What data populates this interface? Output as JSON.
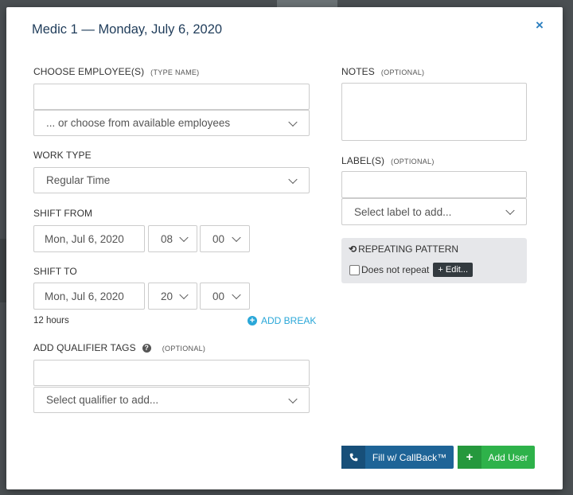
{
  "modal": {
    "title": "Medic 1 — Monday, July 6, 2020",
    "close_glyph": "×"
  },
  "employees": {
    "label": "CHOOSE EMPLOYEE(S)",
    "hint": "(TYPE NAME)",
    "input_value": "",
    "select_value": "... or choose from available employees"
  },
  "work_type": {
    "label": "WORK TYPE",
    "value": "Regular Time"
  },
  "shift_from": {
    "label": "SHIFT FROM",
    "date": "Mon, Jul 6, 2020",
    "hour": "08",
    "minute": "00"
  },
  "shift_to": {
    "label": "SHIFT TO",
    "date": "Mon, Jul 6, 2020",
    "hour": "20",
    "minute": "00"
  },
  "duration": "12 hours",
  "add_break": {
    "icon": "plus-circle-icon",
    "label": "ADD BREAK"
  },
  "qualifier": {
    "label": "ADD QUALIFIER TAGS",
    "help_glyph": "?",
    "optional": "(OPTIONAL)",
    "input_value": "",
    "select_value": "Select qualifier to add..."
  },
  "notes": {
    "label": "NOTES",
    "optional": "(OPTIONAL)",
    "value": ""
  },
  "labels": {
    "label": "LABEL(S)",
    "optional": "(OPTIONAL)",
    "input_value": "",
    "select_value": "Select label to add..."
  },
  "repeating": {
    "icon": "history-icon",
    "title": "REPEATING PATTERN",
    "checkbox_label": "Does not repeat",
    "checked": false,
    "edit_label": "+ Edit..."
  },
  "buttons": {
    "callback_label": "Fill w/ CallBack™",
    "callback_icon": "phone-icon",
    "add_user_label": "Add User",
    "add_user_icon": "plus-icon"
  },
  "colors": {
    "title": "#1f3c5a",
    "accent_link": "#2aa7d8",
    "callback_btn": "#1e6497",
    "add_user_btn": "#2eb24a"
  }
}
